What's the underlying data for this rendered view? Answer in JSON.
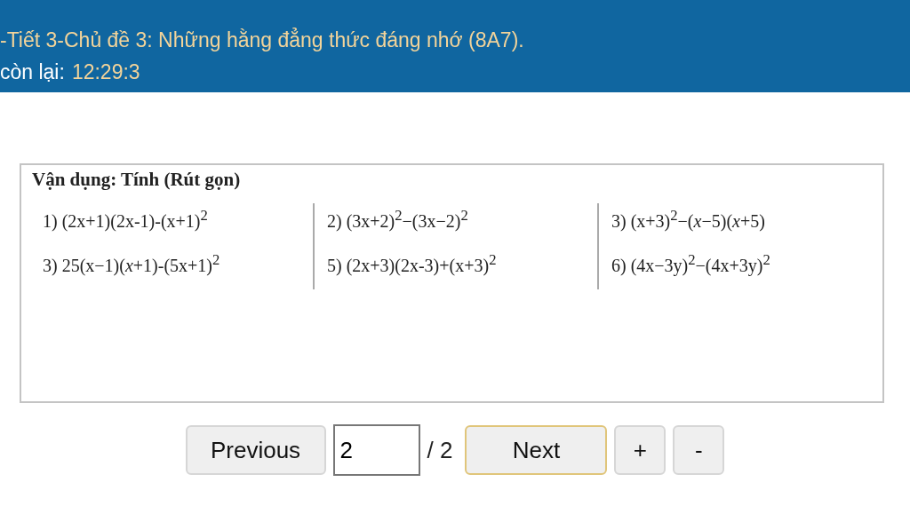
{
  "header": {
    "title": "-Tiết 3-Chủ đề 3: Những hằng đẳng thức đáng nhớ (8A7).",
    "timer_label": "còn lại:",
    "timer_value": "12:29:3"
  },
  "document": {
    "heading": "Vận dụng: Tính (Rút gọn)",
    "columns": [
      [
        "1) (2x+1)(2x-1)-(x+1)$^{2}$",
        "3) 25(x−1)(*x*+1)-(5x+1)$^{2}$"
      ],
      [
        "2) (3x+2)$^{2}$−(3x−2)$^{2}$",
        "5) (2x+3)(2x-3)+(x+3)$^{2}$"
      ],
      [
        "3) (x+3)$^{2}$−(*x*−5)(*x*+5)",
        "6) (4x−3y)$^{2}$−(4x+3y)$^{2}$"
      ]
    ]
  },
  "pager": {
    "previous": {
      "label": "Previous",
      "focused": false
    },
    "page_input": "2",
    "page_total": "/ 2",
    "next": {
      "label": "Next",
      "focused": true
    },
    "zoom_in": {
      "label": "+",
      "focused": false
    },
    "zoom_out": {
      "label": "-",
      "focused": false
    }
  }
}
